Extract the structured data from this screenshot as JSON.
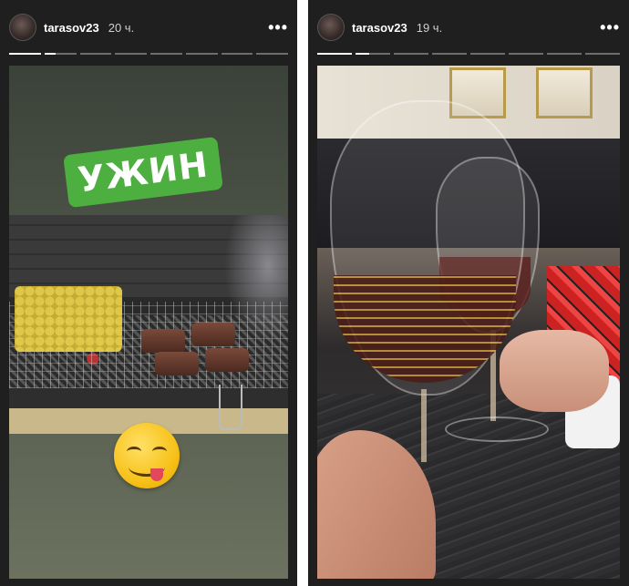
{
  "stories": [
    {
      "username": "tarasov23",
      "time": "20 ч.",
      "more_label": "•••",
      "segments": 8,
      "active_progress": 0.35,
      "sticker_text": "УЖИН"
    },
    {
      "username": "tarasov23",
      "time": "19 ч.",
      "more_label": "•••",
      "segments": 8,
      "active_progress": 0.4
    }
  ],
  "colors": {
    "panel_bg": "#1f1f1f",
    "sticker_green": "#4caf3f",
    "text": "#ffffff",
    "muted": "#cfcfcf"
  }
}
